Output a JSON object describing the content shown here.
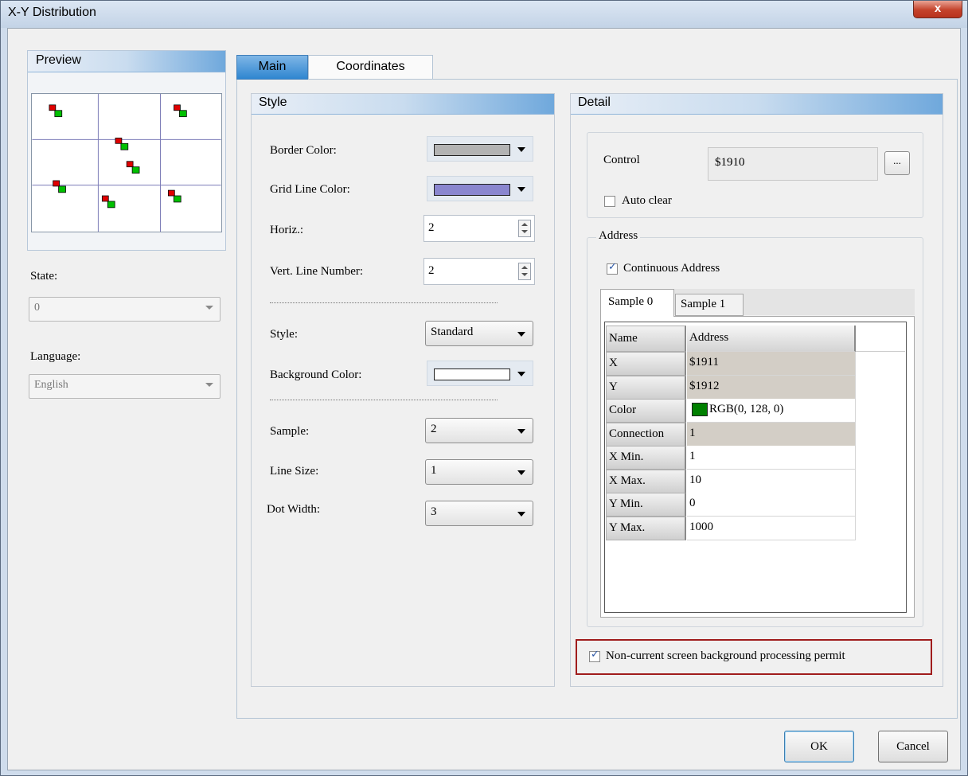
{
  "window": {
    "title": "X-Y Distribution",
    "close_glyph": "x"
  },
  "preview": {
    "title": "Preview",
    "points": [
      {
        "x": 0.12,
        "y": 0.88
      },
      {
        "x": 0.78,
        "y": 0.88
      },
      {
        "x": 0.47,
        "y": 0.64
      },
      {
        "x": 0.53,
        "y": 0.47
      },
      {
        "x": 0.14,
        "y": 0.33
      },
      {
        "x": 0.4,
        "y": 0.22
      },
      {
        "x": 0.75,
        "y": 0.26
      }
    ],
    "colors": {
      "grid": "#7c7cb8",
      "dot_a": "#e00000",
      "dot_b": "#00c000"
    }
  },
  "state": {
    "label": "State:",
    "value": "0"
  },
  "language": {
    "label": "Language:",
    "value": "English"
  },
  "tabs": [
    {
      "label": "Main"
    },
    {
      "label": "Coordinates"
    }
  ],
  "style": {
    "title": "Style",
    "border_color": {
      "label": "Border Color:",
      "color": "#b3b3b3"
    },
    "grid_line_color": {
      "label": "Grid Line Color:",
      "color": "#8a86cf"
    },
    "horiz": {
      "label": "Horiz.:",
      "value": "2"
    },
    "vert": {
      "label": "Vert. Line Number:",
      "value": "2"
    },
    "style_select": {
      "label": "Style:",
      "value": "Standard"
    },
    "background_color": {
      "label": "Background Color:",
      "color": "#ffffff"
    },
    "sample": {
      "label": "Sample:",
      "value": "2"
    },
    "line_size": {
      "label": "Line Size:",
      "value": "1"
    },
    "dot_width": {
      "label": "Dot Width:",
      "value": "3"
    }
  },
  "detail": {
    "title": "Detail",
    "control": {
      "label": "Control",
      "value": "$1910",
      "browse_label": "..."
    },
    "auto_clear": {
      "label": "Auto clear",
      "checked": false
    },
    "address": {
      "legend": "Address",
      "continuous": {
        "label": "Continuous Address",
        "checked": true
      },
      "sample_tabs": [
        "Sample 0",
        "Sample 1"
      ],
      "header": {
        "name": "Name",
        "address": "Address"
      },
      "rows": [
        {
          "name": "X",
          "value": "$1911",
          "shade": "gray"
        },
        {
          "name": "Y",
          "value": "$1912",
          "shade": "gray"
        },
        {
          "name": "Color",
          "value": "RGB(0, 128, 0)",
          "shade": "white",
          "chip": "#008000"
        },
        {
          "name": "Connection",
          "value": "1",
          "shade": "gray"
        },
        {
          "name": "X Min.",
          "value": "1",
          "shade": "white"
        },
        {
          "name": "X Max.",
          "value": "10",
          "shade": "white"
        },
        {
          "name": "Y Min.",
          "value": "0",
          "shade": "white"
        },
        {
          "name": "Y Max.",
          "value": "1000",
          "shade": "white"
        }
      ]
    },
    "permit": {
      "label": "Non-current screen background processing permit",
      "checked": true
    }
  },
  "buttons": {
    "ok": "OK",
    "cancel": "Cancel"
  }
}
